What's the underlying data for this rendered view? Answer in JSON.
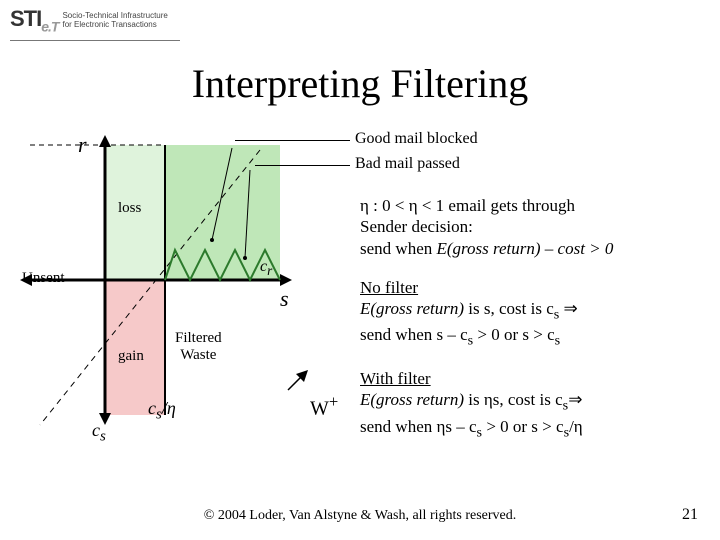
{
  "logo": {
    "mark_main": "STI",
    "mark_sub": "e.T",
    "tag_line1": "Socio-Technical Infrastructure",
    "tag_line2": "for Electronic Transactions"
  },
  "title": "Interpreting Filtering",
  "diagram": {
    "r_label": "r",
    "s_label": "s",
    "unsent": "Unsent",
    "loss": "loss",
    "gain": "gain",
    "filtered_waste": "Filtered\nWaste",
    "cs": "c",
    "cs_sub": "s",
    "cr": "c",
    "cr_sub": "r",
    "cs_over_eta": "c",
    "cs_over_eta_sub": "s",
    "cs_over_eta_tail": "/η",
    "wplus": "W",
    "wplus_sup": "+",
    "leader1": "Good mail blocked",
    "leader2": "Bad mail passed"
  },
  "text": {
    "block1_l1": "η : 0 < η  < 1 email gets through",
    "block1_l2": "Sender decision:",
    "block1_l3_a": "send when ",
    "block1_l3_i": "E(gross return) – cost > 0",
    "block2_l1": "No filter",
    "block2_l2_i": "E(gross return)",
    "block2_l2_a": " is s, cost is c",
    "block2_l2_sub": "s",
    "block2_l2_tail": " ⇒",
    "block2_l3_a": "send when s – c",
    "block2_l3_sub": "s",
    "block2_l3_b": " > 0 or s > c",
    "block2_l3_sub2": "s",
    "block3_l1": "With filter",
    "block3_l2_i": "E(gross return)",
    "block3_l2_a": " is ηs, cost is c",
    "block3_l2_sub": "s",
    "block3_l2_tail": "⇒",
    "block3_l3_a": "send when ηs – c",
    "block3_l3_sub": "s",
    "block3_l3_b": " > 0  or s > c",
    "block3_l3_sub2": "s",
    "block3_l3_tail": "/η"
  },
  "footer": "© 2004 Loder, Van Alstyne & Wash, all rights reserved.",
  "page": "21"
}
